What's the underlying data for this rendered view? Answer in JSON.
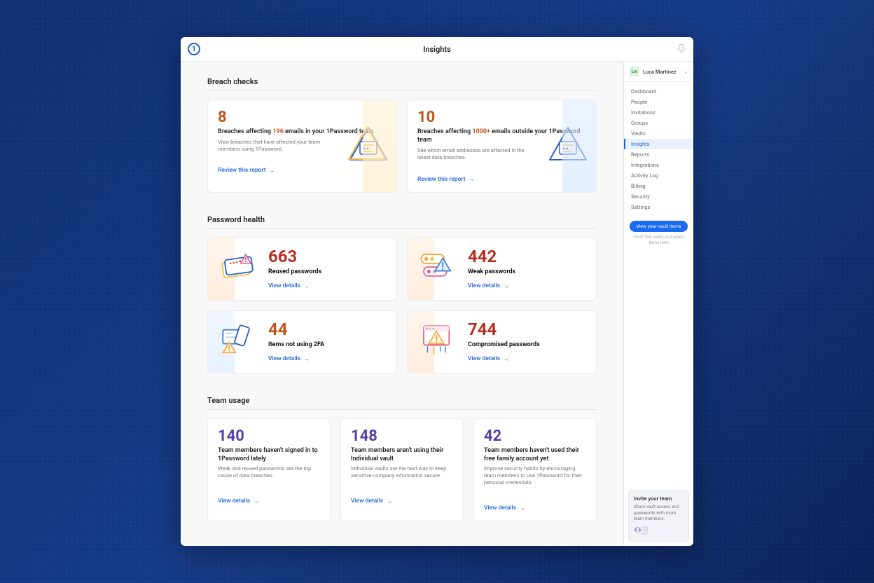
{
  "header": {
    "title": "Insights"
  },
  "user": {
    "initials": "Lm",
    "name": "Luca Martinez"
  },
  "sidebar": {
    "items": [
      {
        "label": "Dashboard"
      },
      {
        "label": "People"
      },
      {
        "label": "Invitations"
      },
      {
        "label": "Groups"
      },
      {
        "label": "Vaults"
      },
      {
        "label": "Insights",
        "active": true
      },
      {
        "label": "Reports"
      },
      {
        "label": "Integrations"
      },
      {
        "label": "Activity Log"
      },
      {
        "label": "Billing"
      },
      {
        "label": "Security"
      },
      {
        "label": "Settings"
      }
    ],
    "vault_button": "View your vault items",
    "vault_hint": "You'll find vaults and saved items here",
    "invite": {
      "title": "Invite your team",
      "desc": "Share vault access and passwords with more team members."
    }
  },
  "breach_section": {
    "title": "Breach checks",
    "cards": [
      {
        "value": "8",
        "headline_pre": "Breaches affecting ",
        "headline_hl": "196",
        "headline_post": " emails in your 1Password team",
        "sub": "View breaches that have affected your team members using 1Password.",
        "link": "Review this report"
      },
      {
        "value": "10",
        "headline_pre": "Breaches affecting ",
        "headline_hl": "1000+",
        "headline_post": " emails outside your 1Password team",
        "sub": "See which email addresses are affected in the latest data breaches.",
        "link": "Review this report"
      }
    ]
  },
  "health_section": {
    "title": "Password health",
    "cards": [
      {
        "value": "663",
        "label": "Reused passwords",
        "link": "View details",
        "color": "red"
      },
      {
        "value": "442",
        "label": "Weak passwords",
        "link": "View details",
        "color": "red"
      },
      {
        "value": "44",
        "label": "Items not using 2FA",
        "link": "View details",
        "color": "orange"
      },
      {
        "value": "744",
        "label": "Compromised passwords",
        "link": "View details",
        "color": "red"
      }
    ]
  },
  "usage_section": {
    "title": "Team usage",
    "cards": [
      {
        "value": "140",
        "headline": "Team members haven't signed in to 1Password lately",
        "sub": "Weak and reused passwords are the top cause of data breaches.",
        "link": "View details"
      },
      {
        "value": "148",
        "headline": "Team members aren't using their Individual vault",
        "sub": "Individual vaults are the best way to keep sensitive company information secure.",
        "link": "View details"
      },
      {
        "value": "42",
        "headline": "Team members haven't used their free family account yet",
        "sub": "Improve security habits by encouraging team members to use 1Password for their personal credentials.",
        "link": "View details"
      }
    ]
  }
}
